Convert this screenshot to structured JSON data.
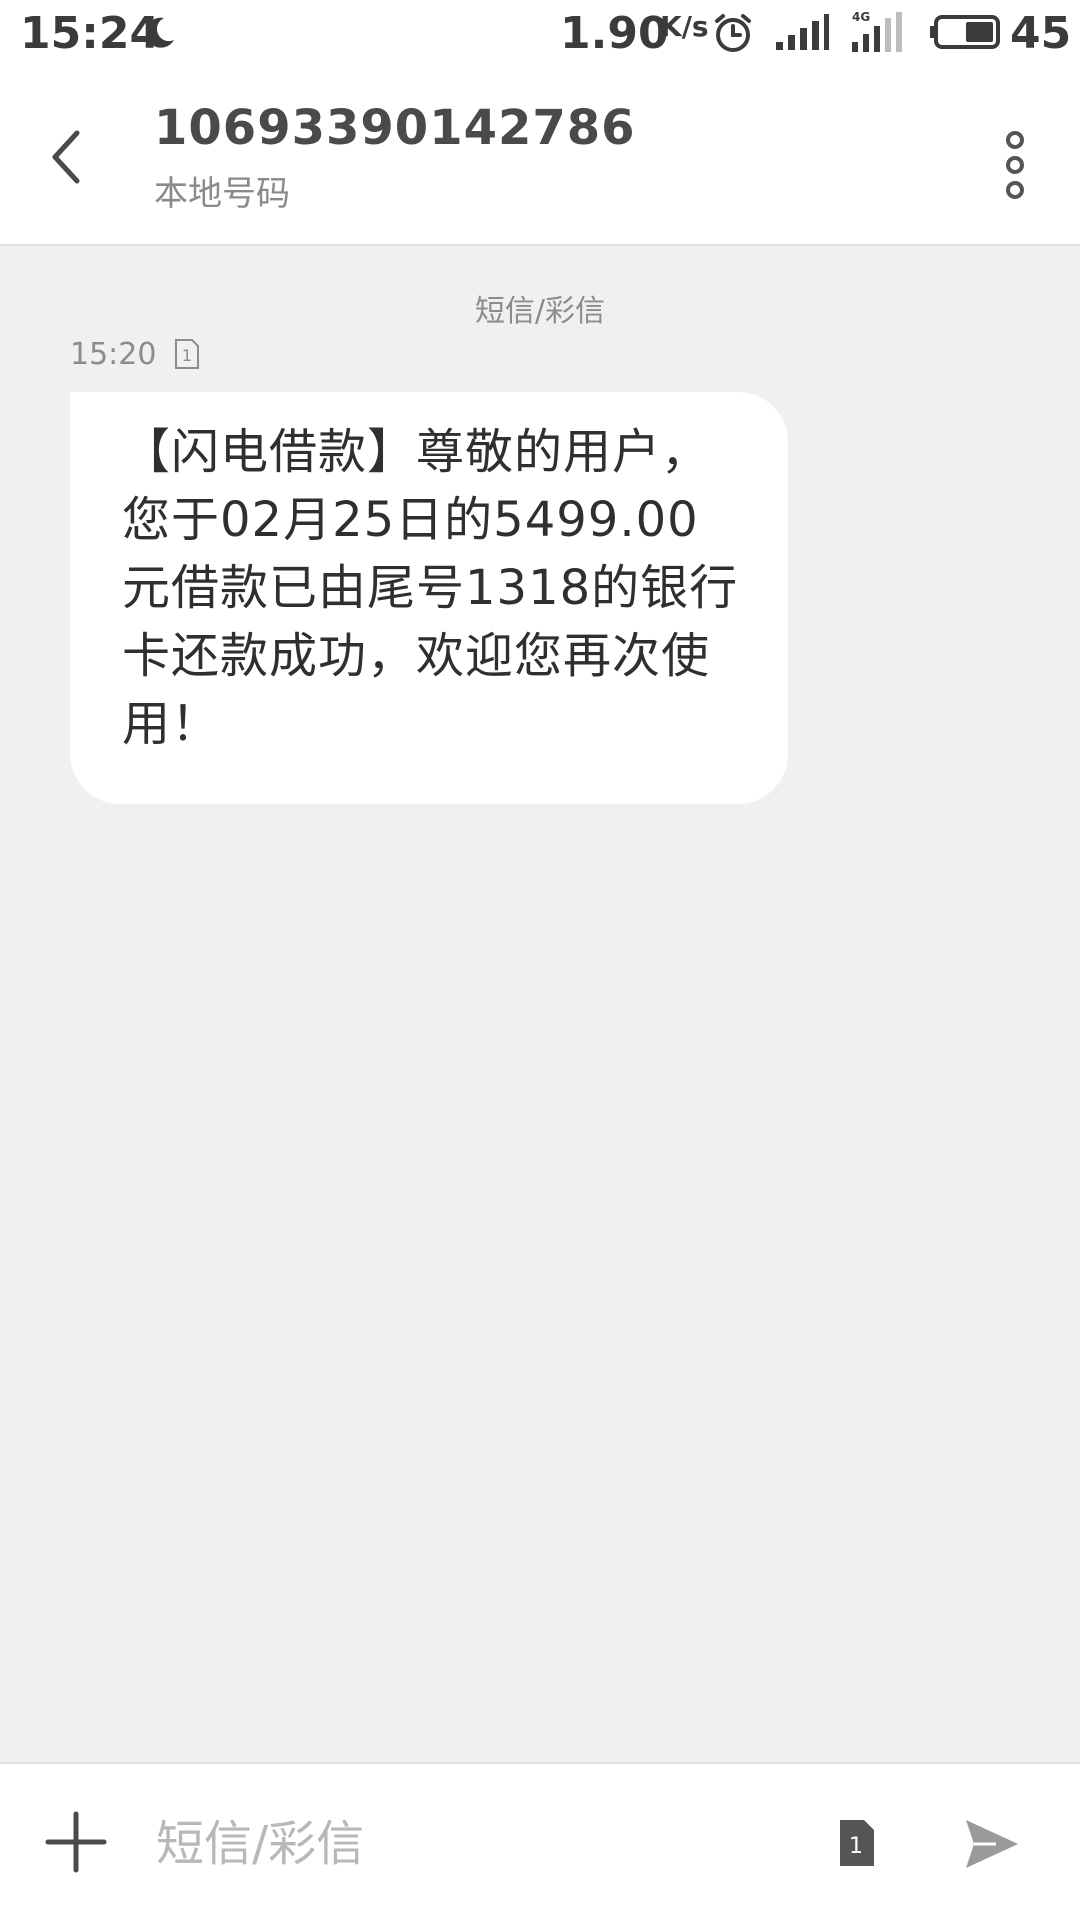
{
  "status_bar": {
    "time": "15:24",
    "net_speed": "1.90",
    "net_speed_unit": "K/s",
    "network_type": "4G",
    "battery_level": "45",
    "icons": [
      "moon-icon",
      "alarm-icon",
      "signal-icon",
      "signal-4g-icon",
      "battery-icon"
    ]
  },
  "header": {
    "contact_number": "10693390142786",
    "contact_subtitle": "本地号码",
    "back_icon": "chevron-left-icon",
    "more_icon": "more-vertical-icon"
  },
  "conversation": {
    "channel_label": "短信/彩信",
    "messages": [
      {
        "time": "15:20",
        "sim": "1",
        "text": "【闪电借款】尊敬的用户，您于02月25日的5499.00元借款已由尾号1318的银行卡还款成功，欢迎您再次使用！"
      }
    ]
  },
  "composer": {
    "placeholder": "短信/彩信",
    "value": "",
    "sim": "1",
    "add_icon": "plus-icon",
    "send_icon": "send-icon"
  },
  "colors": {
    "background": "#f0f0f0",
    "bubble": "#ffffff",
    "text_primary": "#2f2f2f",
    "text_secondary": "#8c8c8c"
  }
}
